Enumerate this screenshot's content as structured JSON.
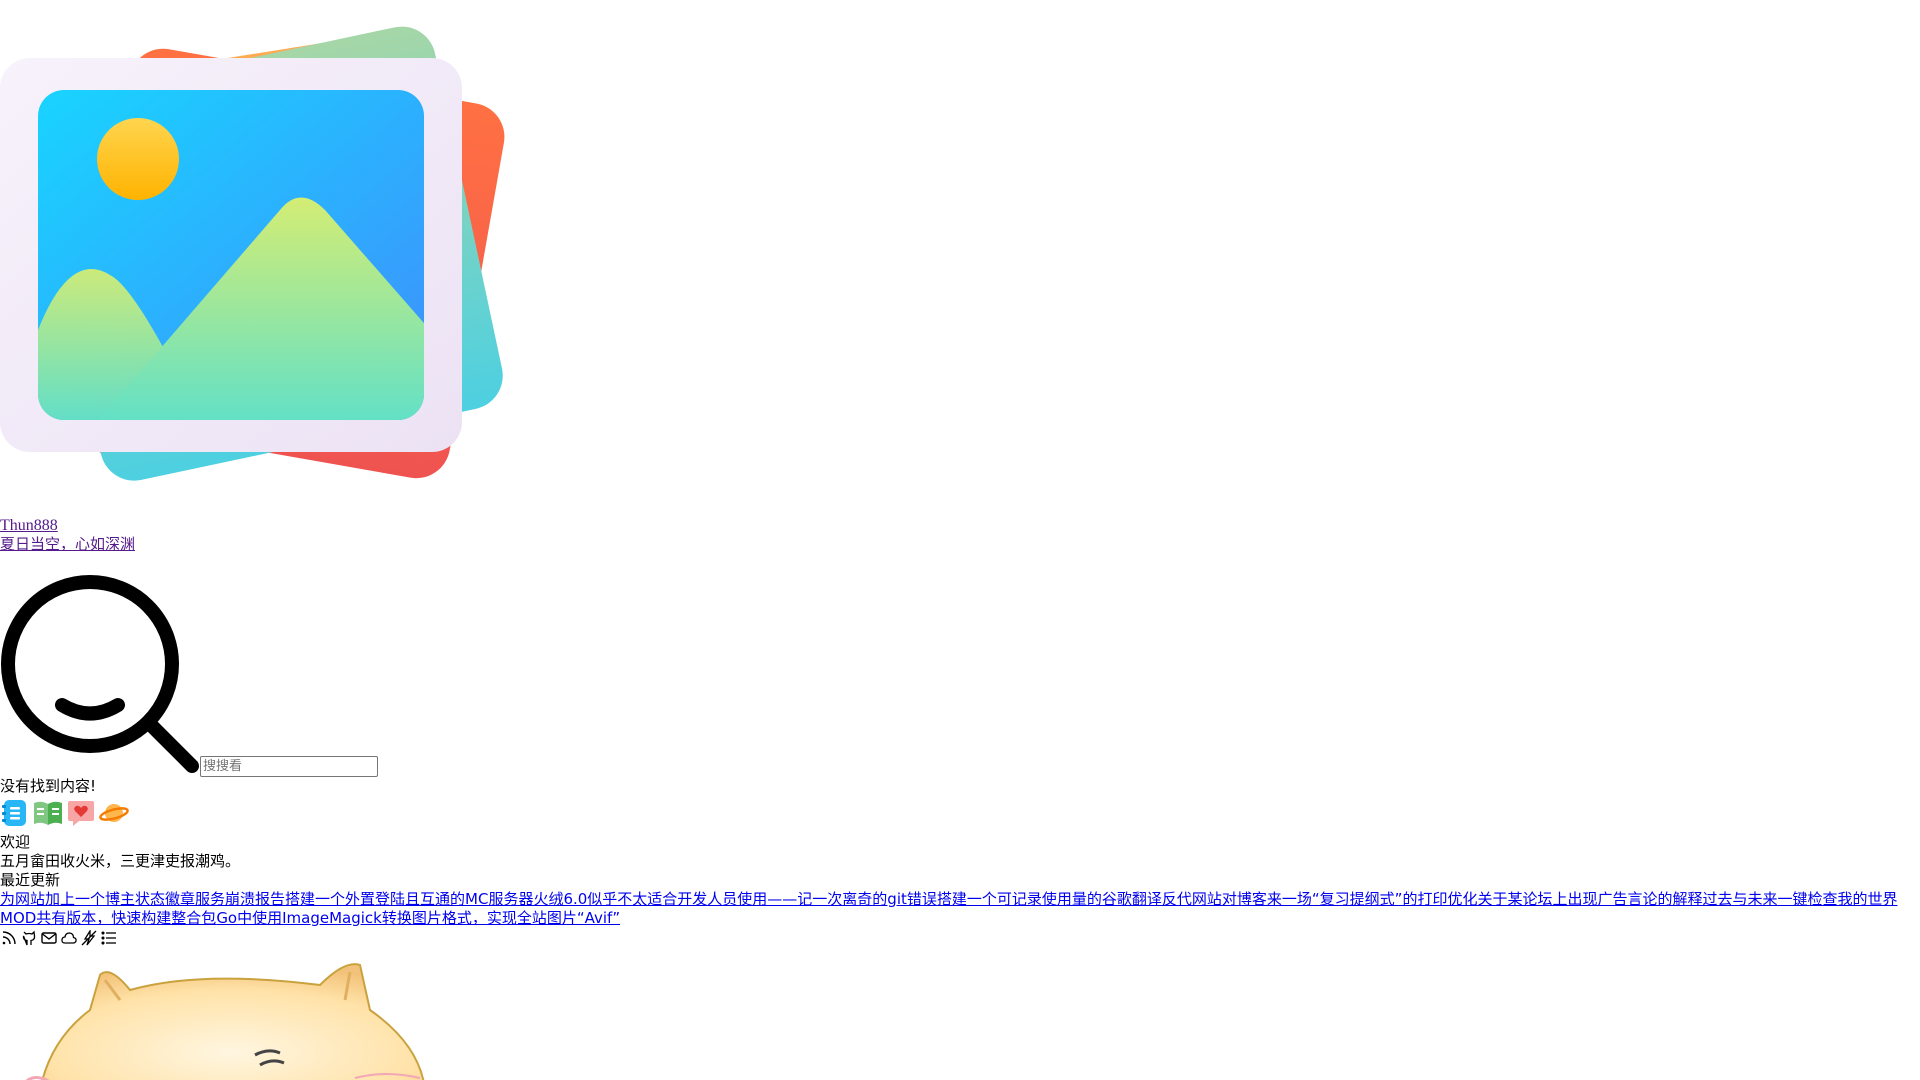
{
  "site": {
    "title": "Thun888",
    "subtitle": "夏日当空，心如深渊"
  },
  "search": {
    "placeholder": "搜搜看",
    "no_results": "没有找到内容!"
  },
  "quick_icons": [
    {
      "name": "notes-icon",
      "color": "#29b6f6"
    },
    {
      "name": "book-icon",
      "color": "#4caf50"
    },
    {
      "name": "heart-message-icon",
      "color": "#ef5350"
    },
    {
      "name": "planet-icon",
      "color": "#ff9800"
    }
  ],
  "welcome": {
    "label": "欢迎",
    "text": "五月畲田收火米，三更津吏报潮鸡。"
  },
  "recent": {
    "label": "最近更新",
    "links": [
      "为网站加上一个博主状态徽章",
      "服务崩溃报告",
      "搭建一个外置登陆且互通的MC服务器",
      "火绒6.0似乎不太适合开发人员使用——记一次离奇的git错误",
      "搭建一个可记录使用量的谷歌翻译反代网站",
      "对博客来一场“复习提纲式”的打印优化",
      "关于某论坛上出现广告言论的解释",
      "过去与未来",
      "一键检查我的世界MOD共有版本，快速构建整合包",
      "Go中使用ImageMagick转换图片格式，实现全站图片“Avif”"
    ]
  },
  "footer_icons": [
    "rss-icon",
    "github-icon",
    "mail-icon",
    "cloud-icon",
    "link-icon",
    "list-icon"
  ],
  "colors": {
    "link": "#0000ee",
    "visited": "#551a8b"
  }
}
